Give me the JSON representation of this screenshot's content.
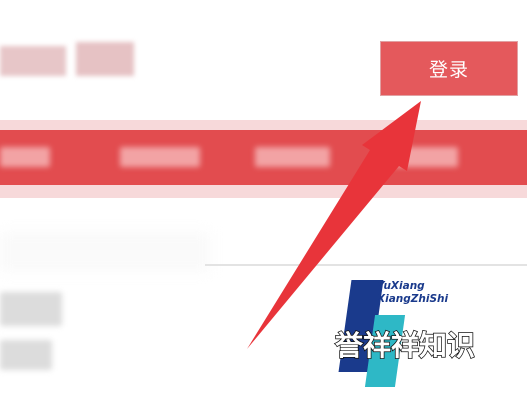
{
  "header": {
    "login_button_label": "登录"
  },
  "nav": {
    "items": [
      "",
      "",
      "",
      ""
    ]
  },
  "watermark": {
    "english_line1": "YuXiang",
    "english_line2": "XiangZhiShi",
    "chinese": "誉祥祥知识"
  },
  "colors": {
    "accent": "#e24c4f",
    "button": "#e4595c",
    "arrow": "#e8343a",
    "logo_blue": "#1a3a8c",
    "logo_teal": "#2eb8c6"
  },
  "icons": {
    "annotation": "arrow-pointer-icon",
    "logo": "brand-logo-icon"
  }
}
